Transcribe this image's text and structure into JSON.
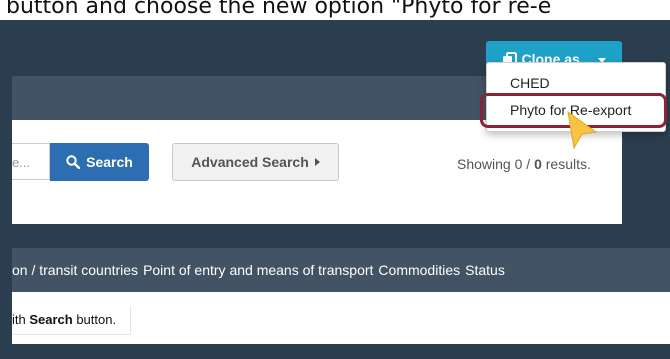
{
  "caption": {
    "text": "button and choose the new option \"Phyto for re-e"
  },
  "header": {
    "clone_button": {
      "label": "Clone as...",
      "icon": "copy-icon",
      "caret": "caret-down-icon"
    }
  },
  "clone_menu": {
    "items": [
      {
        "label": "CHED"
      },
      {
        "label": "Phyto for Re-export"
      }
    ]
  },
  "search": {
    "input_placeholder": "e...",
    "search_button": {
      "label": "Search",
      "icon": "search-icon"
    },
    "advanced_button": {
      "label": "Advanced Search",
      "icon": "caret-right-icon"
    },
    "results": {
      "prefix": "Showing 0 / ",
      "total": "0",
      "suffix": " results."
    }
  },
  "table": {
    "columns": [
      "on / transit countries",
      "Point of entry and means of transport",
      "Commodities",
      "Status"
    ],
    "empty_hint": {
      "prefix": "ith ",
      "bold": "Search",
      "suffix": " button."
    }
  },
  "colors": {
    "page_bg": "#2b3e4f",
    "clone_button": "#1fa2c8",
    "search_button": "#2d6db1",
    "header_bar": "#415364",
    "highlight_border": "#8b2236",
    "cursor": "#f6c343"
  }
}
